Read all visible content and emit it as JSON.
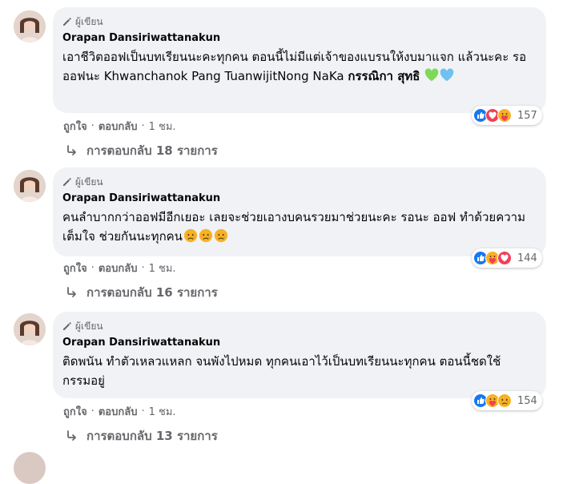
{
  "comments": [
    {
      "badge": "ผู้เขียน",
      "author": "Orapan Dansiriwattanakun",
      "text_plain": "เอาชีวิตออฟเป็นบทเรียนนะคะทุกคน ตอนนี้ไม่มีแต่เจ้าของแบรนให้งบมาแจก แล้วนะคะ รอออฟนะ Khwanchanok Pang TuanwijitNong NaKa ",
      "text_bold": "กรรณิกา สุทธิ",
      "emojis": [
        "green-heart-emoji",
        "blue-heart-emoji"
      ],
      "like": "ถูกใจ",
      "reply": "ตอบกลับ",
      "time": "1 ชม.",
      "reaction_icons": [
        "like-reaction-icon",
        "love-reaction-icon",
        "care-reaction-icon"
      ],
      "reaction_count": "157",
      "replies_label": "การตอบกลับ 18 รายการ"
    },
    {
      "badge": "ผู้เขียน",
      "author": "Orapan Dansiriwattanakun",
      "text_plain": "คนลำบากกว่าออฟมีอีกเยอะ เลยจะช่วยเอางบคนรวยมาช่วยนะคะ รอนะ ออฟ ทำด้วยความเต็มใจ ช่วยกันนะทุกคน",
      "text_bold": "",
      "emojis": [
        "sad-emoji",
        "sad-emoji",
        "sad-emoji"
      ],
      "like": "ถูกใจ",
      "reply": "ตอบกลับ",
      "time": "1 ชม.",
      "reaction_icons": [
        "like-reaction-icon",
        "care-reaction-icon",
        "love-reaction-icon"
      ],
      "reaction_count": "144",
      "replies_label": "การตอบกลับ 16 รายการ"
    },
    {
      "badge": "ผู้เขียน",
      "author": "Orapan Dansiriwattanakun",
      "text_plain": "ติดพนัน ทำตัวเหลวแหลก จนพังไปหมด ทุกคนเอาไว้เป็นบทเรียนนะทุกคน ตอนนี้ชดใช้กรรมอยู่",
      "text_bold": "",
      "emojis": [],
      "like": "ถูกใจ",
      "reply": "ตอบกลับ",
      "time": "1 ชม.",
      "reaction_icons": [
        "like-reaction-icon",
        "care-reaction-icon",
        "sad-reaction-icon"
      ],
      "reaction_count": "154",
      "replies_label": "การตอบกลับ 13 รายการ"
    }
  ],
  "colors": {
    "bubble": "#f0f2f5",
    "muted": "#65676b",
    "like": "#1877f2",
    "love": "#f33e58",
    "care": "#f7b125"
  }
}
